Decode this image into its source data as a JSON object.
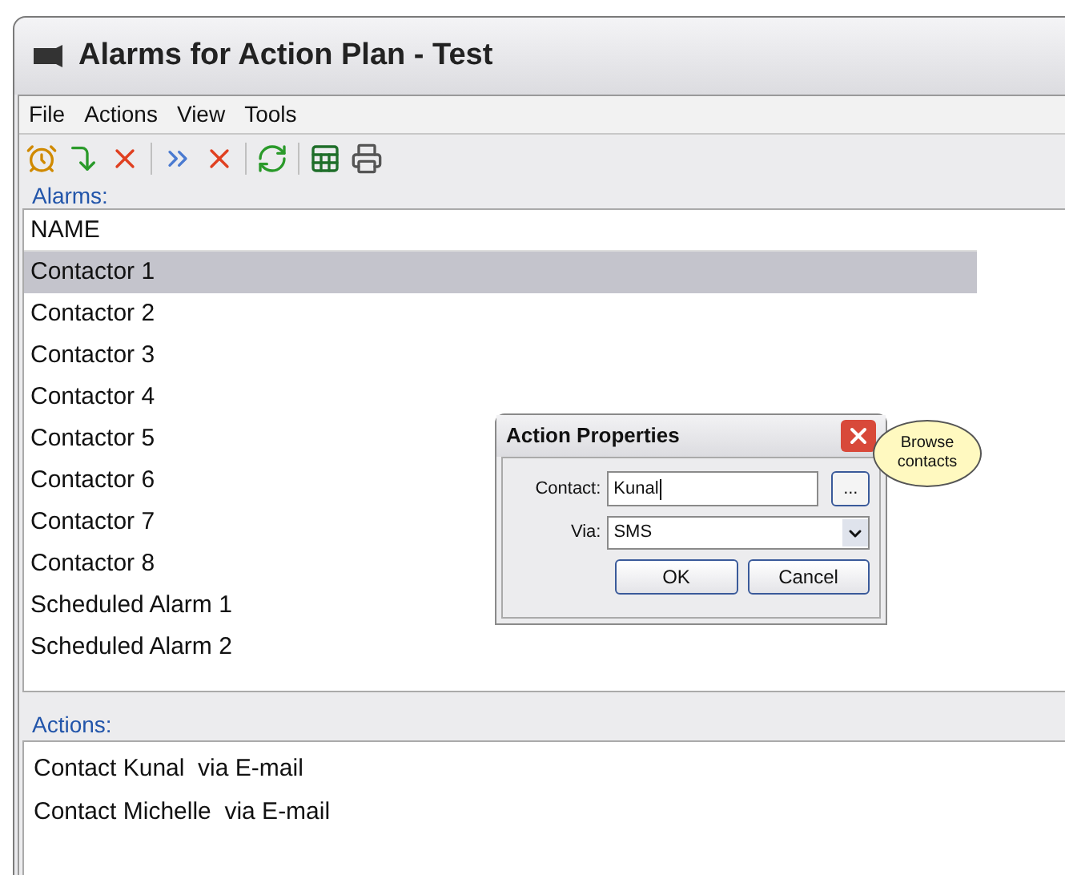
{
  "window": {
    "title": "Alarms for Action Plan - Test"
  },
  "menu": [
    "File",
    "Actions",
    "View",
    "Tools"
  ],
  "alarms": {
    "label": "Alarms:",
    "column": "NAME",
    "rows": [
      {
        "name": "Contactor 1",
        "selected": true
      },
      {
        "name": "Contactor 2",
        "selected": false
      },
      {
        "name": "Contactor 3",
        "selected": false
      },
      {
        "name": "Contactor 4",
        "selected": false
      },
      {
        "name": "Contactor 5",
        "selected": false
      },
      {
        "name": "Contactor 6",
        "selected": false
      },
      {
        "name": "Contactor 7",
        "selected": false
      },
      {
        "name": "Contactor 8",
        "selected": false
      },
      {
        "name": "Scheduled Alarm 1",
        "selected": false
      },
      {
        "name": "Scheduled Alarm 2",
        "selected": false
      }
    ]
  },
  "actions": {
    "label": "Actions:",
    "rows": [
      "Contact Kunal  via E-mail",
      "Contact Michelle  via E-mail"
    ]
  },
  "dialog": {
    "title": "Action Properties",
    "contact_label": "Contact:",
    "contact_value": "Kunal",
    "browse": "...",
    "via_label": "Via:",
    "via_value": "SMS",
    "buttons": [
      "OK",
      "Cancel"
    ]
  },
  "callout": "Browse contacts"
}
